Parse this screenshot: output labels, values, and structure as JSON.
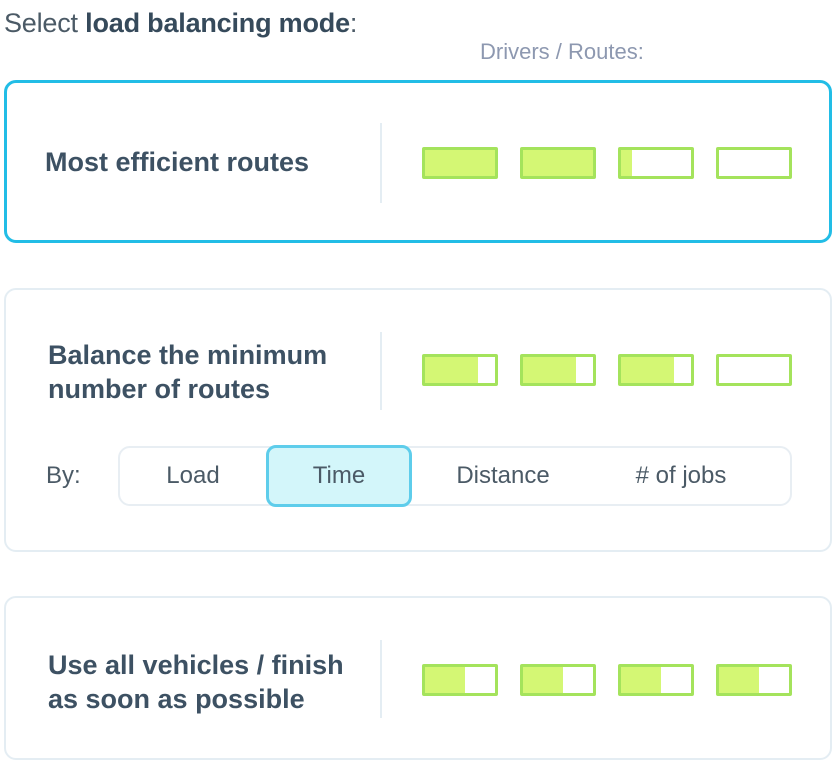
{
  "heading": {
    "prefix": "Select ",
    "bold": "load balancing mode",
    "suffix": ":"
  },
  "column_label": "Drivers / Routes:",
  "colors": {
    "accent": "#22bde6",
    "bar_border": "#a4e35c",
    "bar_fill": "#d4f774",
    "segment_active_bg": "#d3f6fa"
  },
  "modes": [
    {
      "title": "Most efficient routes",
      "selected": true,
      "bars": [
        1.0,
        1.0,
        0.15,
        0.0
      ]
    },
    {
      "title": "Balance the minimum number of routes",
      "selected": false,
      "bars": [
        0.75,
        0.75,
        0.75,
        0.0
      ],
      "by": {
        "label": "By:",
        "options": [
          "Load",
          "Time",
          "Distance",
          "# of jobs"
        ],
        "selected": "Time"
      }
    },
    {
      "title": "Use all vehicles / finish as soon as possible",
      "selected": false,
      "bars": [
        0.57,
        0.57,
        0.57,
        0.57
      ]
    }
  ]
}
